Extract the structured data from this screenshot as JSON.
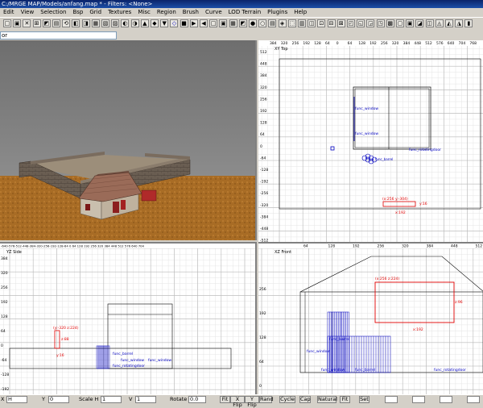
{
  "window": {
    "title": "C:/MRGE MAP/Models/anfang.map * - Filters: <None>"
  },
  "menu": [
    "Edit",
    "View",
    "Selection",
    "Bsp",
    "Grid",
    "Textures",
    "Misc",
    "Region",
    "Brush",
    "Curve",
    "LOD Terrain",
    "Plugins",
    "Help"
  ],
  "texture_field": "or",
  "views": {
    "xy": {
      "label": "XY Top",
      "x_ticks": [
        "384",
        "320",
        "256",
        "192",
        "128",
        "64",
        "0",
        "64",
        "128",
        "192",
        "256",
        "320",
        "384",
        "448",
        "512",
        "576",
        "640",
        "704",
        "768"
      ],
      "y_ticks": [
        "512",
        "448",
        "384",
        "320",
        "256",
        "192",
        "128",
        "64",
        "0",
        "-64",
        "-128",
        "-192",
        "-256",
        "-320",
        "-384",
        "-448",
        "-512"
      ],
      "entities": [
        "func_window",
        "func_window",
        "func_rotatingdoor",
        "func_barrel",
        "func_barrel"
      ],
      "sel_coord": "(x:256 y:-304)",
      "sel_w": "x:192",
      "sel_h": "y:16"
    },
    "yz": {
      "label": "YZ Side",
      "top_ticks": "-640-576-512-448-384-320-256-192-128-64  0  64 128 192 256 320 384 448 512 576 640 704",
      "y_ticks": [
        "384",
        "320",
        "256",
        "192",
        "128",
        "64",
        "0",
        "-64",
        "-128",
        "-192"
      ],
      "sel_coord": "(y:-320 z:224)",
      "sel_h": "z:88",
      "sel_w": "y:16",
      "entities": [
        "func_barrel",
        "func_window",
        "func_window",
        "func_rotatingdoor"
      ]
    },
    "xz": {
      "label": "XZ Front",
      "x_ticks": [
        "64",
        "128",
        "192",
        "256",
        "320",
        "384",
        "448",
        "512"
      ],
      "y_ticks": [
        "256",
        "192",
        "128",
        "64",
        "0"
      ],
      "sel_coord": "(x:256 z:224)",
      "sel_w": "x:192",
      "sel_h": "z:96",
      "entities": [
        "func_barrel",
        "func_window",
        "func_window",
        "func_barrel",
        "func_rotatingdoor"
      ]
    }
  },
  "status": {
    "x_label": "X",
    "x_val": "H",
    "y_label": "Y",
    "y_val": "0",
    "scale_label": "Scale H",
    "scale_h": "1",
    "v_label": "V",
    "v_val": "1",
    "rotate_label": "Rotate",
    "rotate_val": "0.0",
    "buttons": [
      "Fit",
      "X Flip",
      "Y Flip",
      "Rand",
      "Cycle",
      "Cap",
      "Natural",
      "Fit",
      "Set"
    ]
  },
  "colors": {
    "grid_bg": "#ffffff",
    "grid_minor": "#e4e4e4",
    "grid_major": "#b8b8b8",
    "brush": "#000000",
    "entity": "#0000c0",
    "selected": "#e00000",
    "viewport_sky": "#7a7a7a",
    "ground": "#a9702a"
  }
}
